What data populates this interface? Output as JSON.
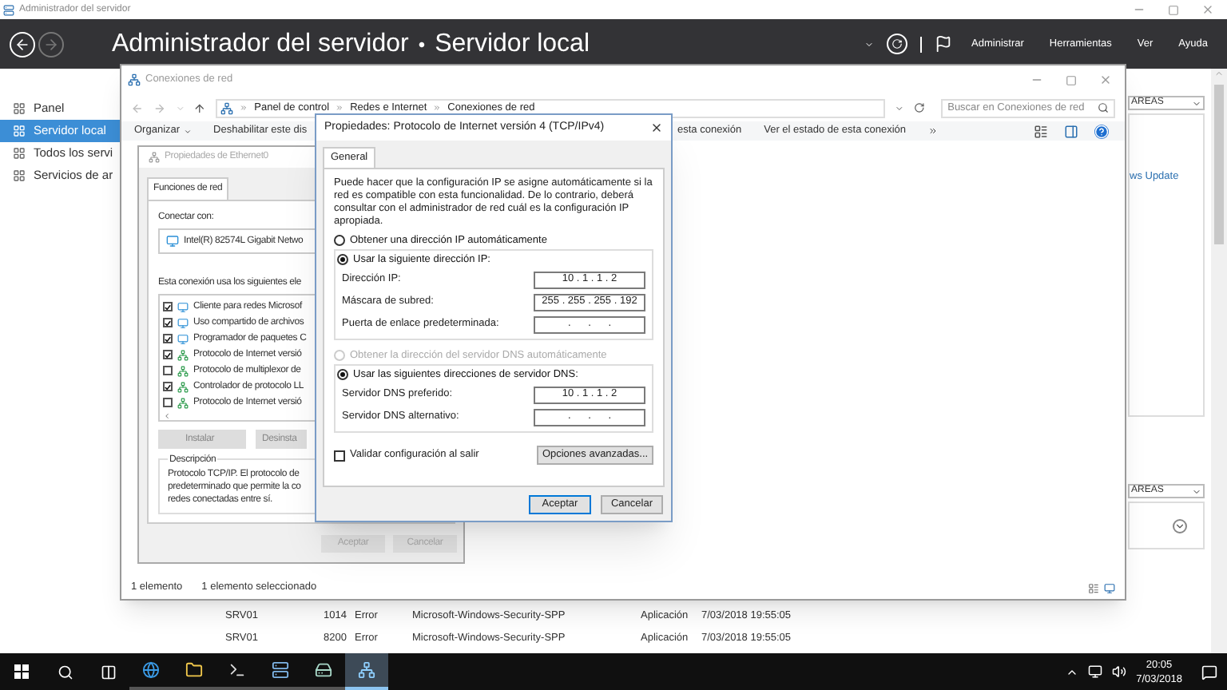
{
  "app_window": {
    "title": "Administrador del servidor"
  },
  "header": {
    "title": "Administrador del servidor",
    "separator": "•",
    "page": "Servidor local",
    "menus": [
      "Administrar",
      "Herramientas",
      "Ver",
      "Ayuda"
    ]
  },
  "sidebar": [
    {
      "label": "Panel",
      "selected": false
    },
    {
      "label": "Servidor local",
      "selected": true
    },
    {
      "label": "Todos los servi",
      "selected": false
    },
    {
      "label": "Servicios de ar",
      "selected": false
    }
  ],
  "tasks_dropdowns": [
    "AREAS",
    "AREAS"
  ],
  "update_link": "ws Update",
  "events": [
    {
      "server": "SRV01",
      "id": "1014",
      "level": "Error",
      "source": "Microsoft-Windows-Security-SPP",
      "log": "Aplicación",
      "date": "7/03/2018 19:55:05"
    },
    {
      "server": "SRV01",
      "id": "8200",
      "level": "Error",
      "source": "Microsoft-Windows-Security-SPP",
      "log": "Aplicación",
      "date": "7/03/2018 19:55:05"
    }
  ],
  "network_window": {
    "title": "Conexiones de red",
    "breadcrumb": [
      "Panel de control",
      "Redes e Internet",
      "Conexiones de red"
    ],
    "search": {
      "placeholder": "Buscar en Conexiones de red"
    },
    "toolbar_left": [
      "Organizar",
      "Deshabilitar este dis"
    ],
    "toolbar_right": [
      "esta conexión",
      "Ver el estado de esta conexión"
    ],
    "status": [
      "1 elemento",
      "1 elemento seleccionado"
    ]
  },
  "ethernet_window": {
    "title": "Propiedades de Ethernet0",
    "tabs": [
      {
        "label": "Funciones de red",
        "selected": true
      }
    ],
    "connect_label": "Conectar con:",
    "adapter": "Intel(R) 82574L Gigabit Netwo",
    "items_label": "Esta conexión usa los siguientes ele",
    "items": [
      {
        "label": "Cliente para redes Microsof",
        "checked": true,
        "kind": "client"
      },
      {
        "label": "Uso compartido de archivos",
        "checked": true,
        "kind": "client"
      },
      {
        "label": "Programador de paquetes C",
        "checked": true,
        "kind": "client"
      },
      {
        "label": "Protocolo de Internet versió",
        "checked": true,
        "kind": "protocol"
      },
      {
        "label": "Protocolo de multiplexor de",
        "checked": false,
        "kind": "protocol"
      },
      {
        "label": "Controlador de protocolo LL",
        "checked": true,
        "kind": "protocol"
      },
      {
        "label": "Protocolo de Internet versió",
        "checked": false,
        "kind": "protocol"
      }
    ],
    "item_buttons": [
      "Instalar",
      "Desinsta"
    ],
    "description": {
      "legend": "Descripción",
      "lines": [
        "Protocolo TCP/IP. El protocolo de",
        "predeterminado que permite la co",
        "redes conectadas entre sí."
      ]
    },
    "buttons": [
      "Aceptar",
      "Cancelar"
    ]
  },
  "ip_dialog": {
    "title": "Propiedades: Protocolo de Internet versión 4 (TCP/IPv4)",
    "tabs": [
      {
        "label": "General",
        "selected": true
      }
    ],
    "intro": "Puede hacer que la configuración IP se asigne automáticamente si la red es compatible con esta funcionalidad. De lo contrario, deberá consultar con el administrador de red cuál es la configuración IP apropiada.",
    "ip_options": [
      {
        "label": "Obtener una dirección IP automáticamente",
        "selected": false,
        "disabled": false
      },
      {
        "label": "Usar la siguiente dirección IP:",
        "selected": true,
        "disabled": false
      }
    ],
    "ip_fields": [
      {
        "label": "Dirección IP:",
        "value": "10 . 1 . 1 . 2"
      },
      {
        "label": "Máscara de subred:",
        "value": "255 . 255 . 255 . 192"
      },
      {
        "label": "Puerta de enlace predeterminada:",
        "value": ".      .      ."
      }
    ],
    "dns_options": [
      {
        "label": "Obtener la dirección del servidor DNS automáticamente",
        "selected": false,
        "disabled": true
      },
      {
        "label": "Usar las siguientes direcciones de servidor DNS:",
        "selected": true,
        "disabled": false
      }
    ],
    "dns_fields": [
      {
        "label": "Servidor DNS preferido:",
        "value": "10 . 1 . 1 . 2"
      },
      {
        "label": "Servidor DNS alternativo:",
        "value": ".      .      ."
      }
    ],
    "validate": {
      "label": "Validar configuración al salir",
      "checked": false
    },
    "advanced_button": "Opciones avanzadas...",
    "buttons": [
      {
        "label": "Aceptar",
        "default": true
      },
      {
        "label": "Cancelar",
        "default": false
      }
    ]
  },
  "taskbar": {
    "apps": [
      {
        "kind": "browser",
        "selected": false
      },
      {
        "kind": "folder",
        "selected": false
      },
      {
        "kind": "terminal",
        "selected": false
      },
      {
        "kind": "server",
        "selected": false
      },
      {
        "kind": "disk",
        "selected": false
      },
      {
        "kind": "network",
        "selected": true
      }
    ],
    "time": "20:05",
    "date": "7/03/2018"
  }
}
